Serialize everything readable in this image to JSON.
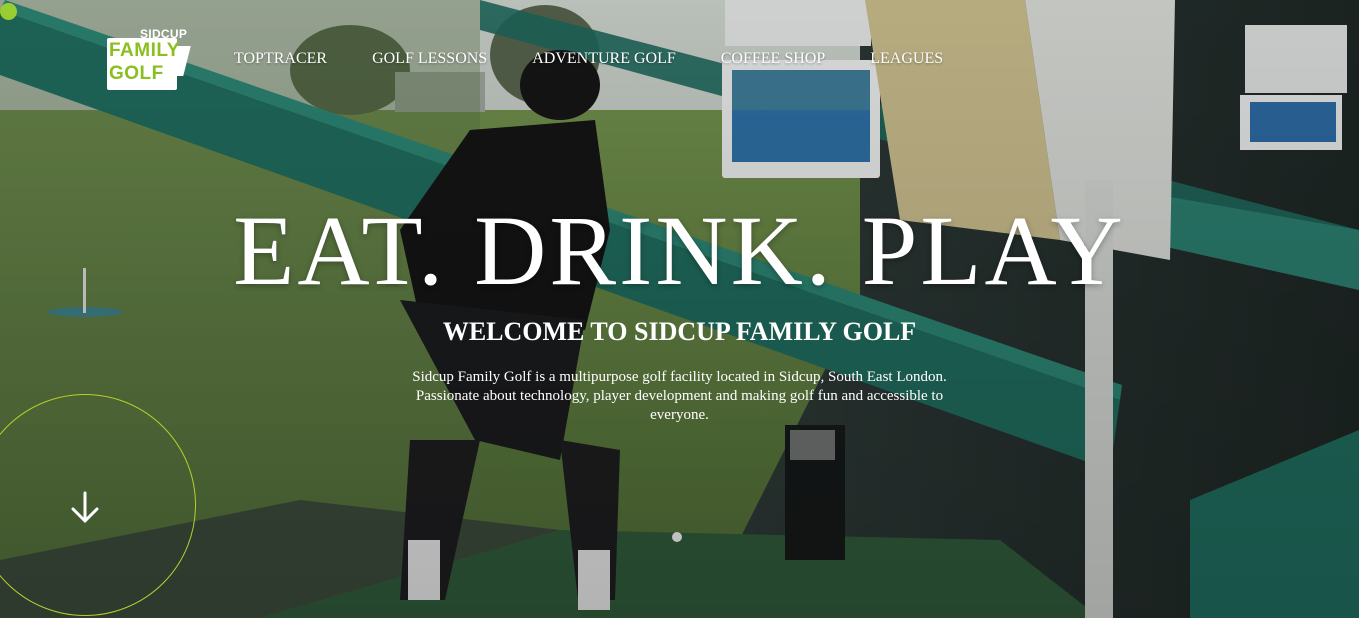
{
  "brand": {
    "logo_top": "SIDCUP",
    "logo_line1": "FAMILY",
    "logo_line2": "GOLF",
    "accent_color": "#8bbf1f"
  },
  "nav": {
    "items": [
      {
        "label": "TOPTRACER"
      },
      {
        "label": "GOLF LESSONS"
      },
      {
        "label": "ADVENTURE GOLF"
      },
      {
        "label": "COFFEE SHOP"
      },
      {
        "label": "LEAGUES"
      }
    ]
  },
  "hero": {
    "headline": "EAT. DRINK. PLAY",
    "subheading": "WELCOME TO SIDCUP FAMILY GOLF",
    "intro": "Sidcup Family Golf is a multipurpose golf facility located in Sidcup, South East London. Passionate about technology, player development and making golf fun and accessible to everyone.",
    "scroll_icon": "arrow-down-icon"
  }
}
